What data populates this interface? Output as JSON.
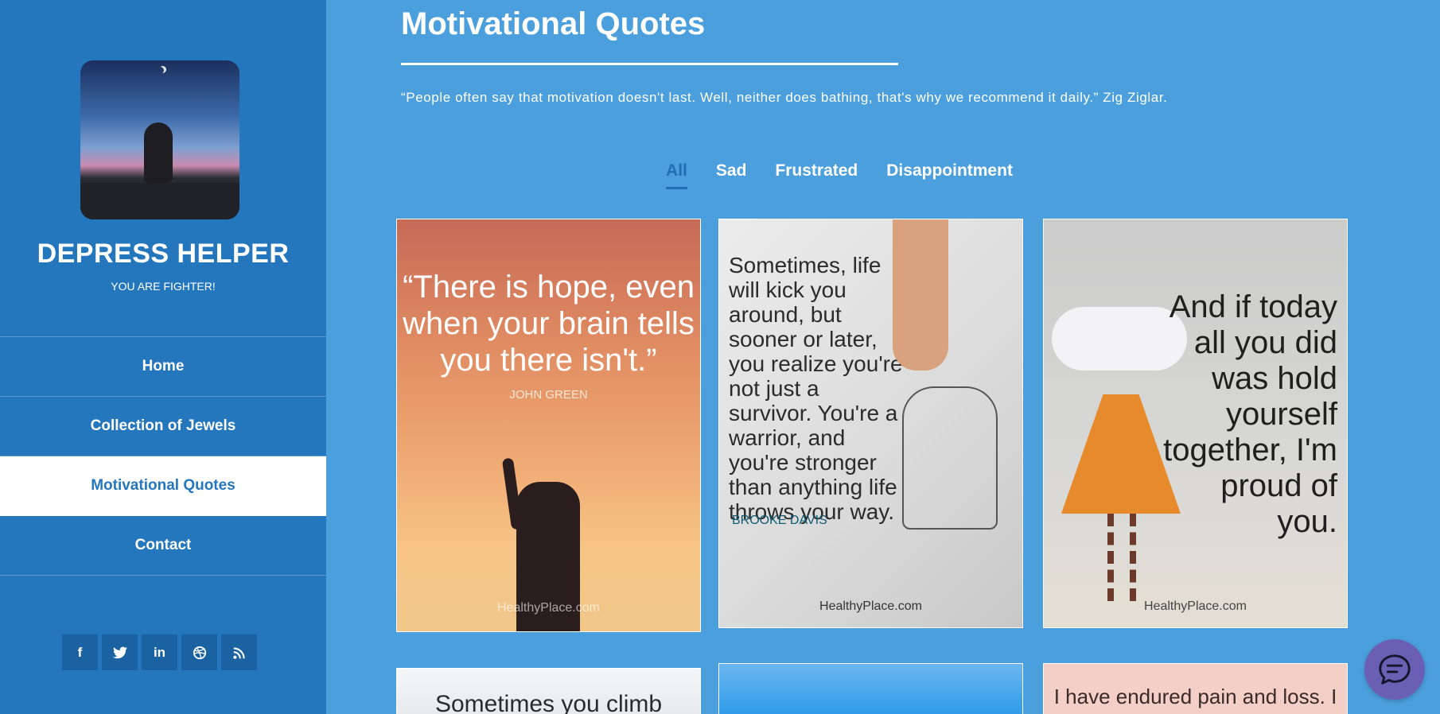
{
  "sidebar": {
    "title": "DEPRESS HELPER",
    "tagline": "YOU ARE FIGHTER!",
    "nav": [
      {
        "label": "Home"
      },
      {
        "label": "Collection of Jewels"
      },
      {
        "label": "Motivational Quotes"
      },
      {
        "label": "Contact"
      }
    ],
    "active_nav": "Motivational Quotes",
    "social": [
      {
        "icon": "facebook-icon",
        "glyph": "f"
      },
      {
        "icon": "twitter-icon",
        "glyph": "t"
      },
      {
        "icon": "linkedin-icon",
        "glyph": "in"
      },
      {
        "icon": "dribbble-icon",
        "glyph": "◎"
      },
      {
        "icon": "rss-icon",
        "glyph": "◠"
      }
    ]
  },
  "main": {
    "title": "Motivational Quotes",
    "intro": "“People often say that motivation doesn't last. Well, neither does bathing, that's why we recommend it daily.” Zig Ziglar.",
    "filters": [
      "All",
      "Sad",
      "Frustrated",
      "Disappointment"
    ],
    "active_filter": "All",
    "cards": [
      {
        "quote": "“There is hope, even when your brain tells you there isn't.”",
        "author": "JOHN GREEN",
        "brand": "HealthyPlace.com"
      },
      {
        "quote": "Sometimes, life will kick you around, but sooner or later, you realize you're not just a survivor. You're a warrior, and you're stronger than anything life throws your way.",
        "author": "BROOKE DAVIS",
        "brand": "HealthyPlace.com"
      },
      {
        "quote": "And if today all you did was hold yourself together, I'm proud of you.",
        "brand": "HealthyPlace.com"
      },
      {
        "quote": "Sometimes you climb"
      },
      {
        "quote": ""
      },
      {
        "quote": "I have endured pain and loss. I"
      }
    ]
  },
  "colors": {
    "sidebar_bg": "#2476bd",
    "main_bg": "#4b9fdc",
    "active_accent": "#1f6fb4",
    "chat_button": "#6b5fb3"
  }
}
